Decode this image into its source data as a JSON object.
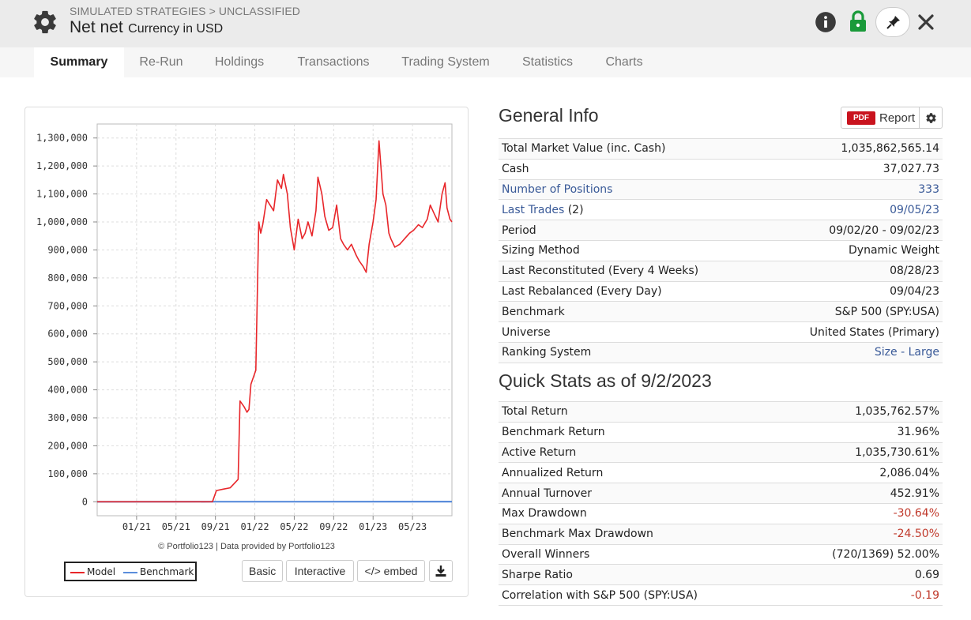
{
  "header": {
    "breadcrumb": "SIMULATED STRATEGIES > UNCLASSIFIED",
    "title": "Net net",
    "subtitle": "Currency in USD"
  },
  "tabs": [
    {
      "label": "Summary",
      "active": true
    },
    {
      "label": "Re-Run"
    },
    {
      "label": "Holdings"
    },
    {
      "label": "Transactions"
    },
    {
      "label": "Trading System"
    },
    {
      "label": "Statistics"
    },
    {
      "label": "Charts"
    }
  ],
  "chart_data": {
    "type": "line",
    "y_ticks": [
      "1,300,000",
      "1,200,000",
      "1,100,000",
      "1,000,000",
      "900,000",
      "800,000",
      "700,000",
      "600,000",
      "500,000",
      "400,000",
      "300,000",
      "200,000",
      "100,000",
      "0"
    ],
    "x_ticks": [
      "01/21",
      "05/21",
      "09/21",
      "01/22",
      "05/22",
      "09/22",
      "01/23",
      "05/23"
    ],
    "ylim": [
      -50000,
      1350000
    ],
    "xlim": [
      0,
      36
    ],
    "grid": true,
    "legend": "bottom-left",
    "series": [
      {
        "name": "Model",
        "color": "#e8262a",
        "x": [
          0,
          4,
          8,
          11.7,
          12.1,
          12.8,
          13.5,
          14.3,
          14.5,
          14.9,
          15.2,
          15.4,
          15.6,
          15.9,
          16.1,
          16.4,
          16.6,
          16.8,
          17.2,
          17.9,
          18.3,
          18.7,
          18.9,
          19.3,
          19.6,
          20,
          20.4,
          20.8,
          21.1,
          21.4,
          21.8,
          22.2,
          22.4,
          22.8,
          23.1,
          23.5,
          23.9,
          24.3,
          24.7,
          25,
          25.4,
          25.8,
          26.3,
          26.6,
          27,
          27.3,
          27.6,
          28,
          28.3,
          28.6,
          29,
          29.3,
          29.6,
          29.8,
          30.2,
          30.7,
          31.2,
          31.7,
          32.1,
          32.6,
          33,
          33.5,
          33.8,
          34.2,
          34.6,
          35,
          35.3,
          35.5,
          35.8,
          36
        ],
        "y": [
          0,
          0,
          0,
          0,
          40000,
          45000,
          50000,
          80000,
          360000,
          340000,
          320000,
          330000,
          420000,
          450000,
          470000,
          1000000,
          960000,
          990000,
          1080000,
          1040000,
          1150000,
          1120000,
          1170000,
          1100000,
          980000,
          900000,
          1010000,
          940000,
          960000,
          1000000,
          950000,
          1040000,
          1160000,
          1100000,
          1020000,
          970000,
          980000,
          1060000,
          940000,
          920000,
          900000,
          920000,
          880000,
          860000,
          840000,
          820000,
          920000,
          1000000,
          1080000,
          1290000,
          1100000,
          1060000,
          960000,
          940000,
          910000,
          920000,
          940000,
          960000,
          970000,
          990000,
          980000,
          1010000,
          1060000,
          1030000,
          1000000,
          1100000,
          1140000,
          1050000,
          1010000,
          1000000
        ]
      },
      {
        "name": "Benchmark",
        "color": "#5b8ddb",
        "x": [
          0,
          12,
          36
        ],
        "y": [
          0,
          300,
          450
        ]
      }
    ]
  },
  "chart": {
    "credit": "© Portfolio123 | Data provided by Portfolio123",
    "legend_model": "Model",
    "legend_benchmark": "Benchmark",
    "btn_basic": "Basic",
    "btn_interactive": "Interactive",
    "btn_embed": "</> embed"
  },
  "general_info": {
    "title": "General Info",
    "report_badge": "PDF",
    "report_label": "Report",
    "rows": [
      {
        "label": "Total Market Value (inc. Cash)",
        "value": "1,035,862,565.14"
      },
      {
        "label": "Cash",
        "value": "37,027.73"
      },
      {
        "label": "Number of Positions",
        "value": "333",
        "link": true
      },
      {
        "label": "Last Trades",
        "label_extra": " (2)",
        "value": "09/05/23",
        "link": true
      },
      {
        "label": "Period",
        "value": "09/02/20 - 09/02/23"
      },
      {
        "label": "Sizing Method",
        "value": "Dynamic Weight"
      },
      {
        "label": "Last Reconstituted (Every 4 Weeks)",
        "value": "08/28/23"
      },
      {
        "label": "Last Rebalanced (Every Day)",
        "value": "09/04/23"
      },
      {
        "label": "Benchmark",
        "value": "S&P 500 (SPY:USA)"
      },
      {
        "label": "Universe",
        "value": "United States (Primary)"
      },
      {
        "label": "Ranking System",
        "value": "Size - Large",
        "value_link": true
      }
    ]
  },
  "quick_stats": {
    "title": "Quick Stats as of 9/2/2023",
    "rows": [
      {
        "label": "Total Return",
        "value": "1,035,762.57%"
      },
      {
        "label": "Benchmark Return",
        "value": "31.96%"
      },
      {
        "label": "Active Return",
        "value": "1,035,730.61%"
      },
      {
        "label": "Annualized Return",
        "value": "2,086.04%"
      },
      {
        "label": "Annual Turnover",
        "value": "452.91%"
      },
      {
        "label": "Max Drawdown",
        "value": "-30.64%",
        "negative": true
      },
      {
        "label": "Benchmark Max Drawdown",
        "value": "-24.50%",
        "negative": true
      },
      {
        "label": "Overall Winners",
        "value": "(720/1369) 52.00%"
      },
      {
        "label": "Sharpe Ratio",
        "value": "0.69"
      },
      {
        "label": "Correlation with S&P 500 (SPY:USA)",
        "value": "-0.19",
        "negative": true
      }
    ]
  }
}
